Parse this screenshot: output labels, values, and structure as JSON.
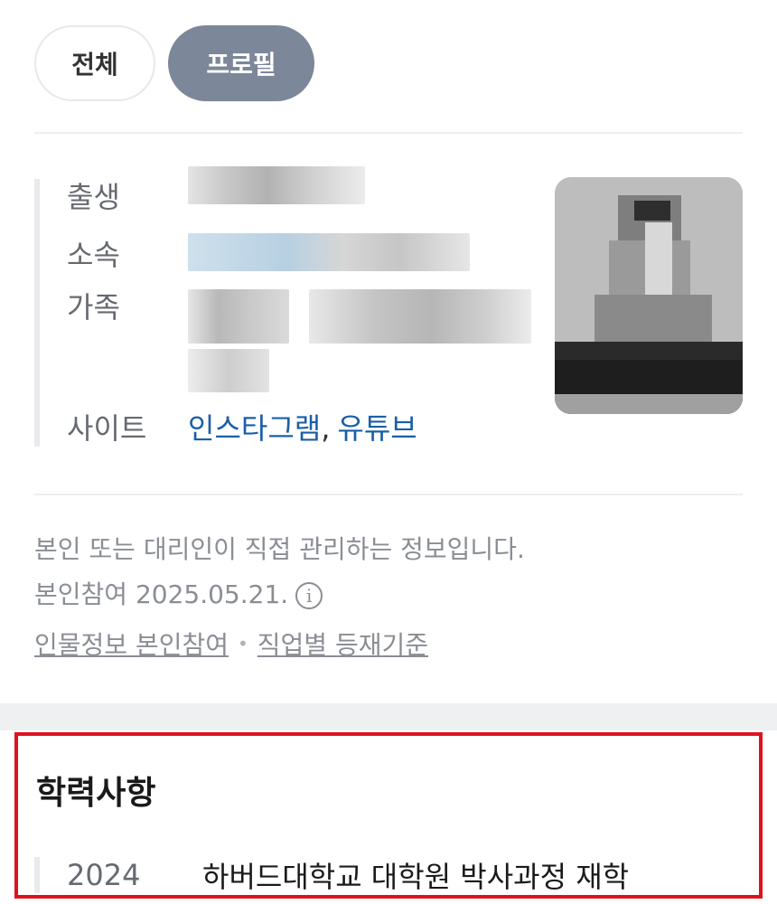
{
  "tabs": [
    {
      "label": "전체",
      "active": false
    },
    {
      "label": "프로필",
      "active": true
    }
  ],
  "profile": {
    "birth_label": "출생",
    "affiliation_label": "소속",
    "family_label": "가족",
    "site_label": "사이트",
    "site_links": [
      "인스타그램",
      "유튜브"
    ],
    "site_separator": ","
  },
  "notice": {
    "line1": "본인 또는 대리인이 직접 관리하는 정보입니다.",
    "line2": "본인참여 2025.05.21.",
    "info_icon": "info-icon"
  },
  "footer_links": [
    "인물정보 본인참여",
    "직업별 등재기준"
  ],
  "education": {
    "title": "학력사항",
    "items": [
      {
        "year": "2024",
        "desc": "하버드대학교 대학원 박사과정 재학"
      }
    ]
  },
  "colors": {
    "active_tab": "#7c8799",
    "link": "#1a5fa6",
    "highlight_border": "#e0111f"
  }
}
